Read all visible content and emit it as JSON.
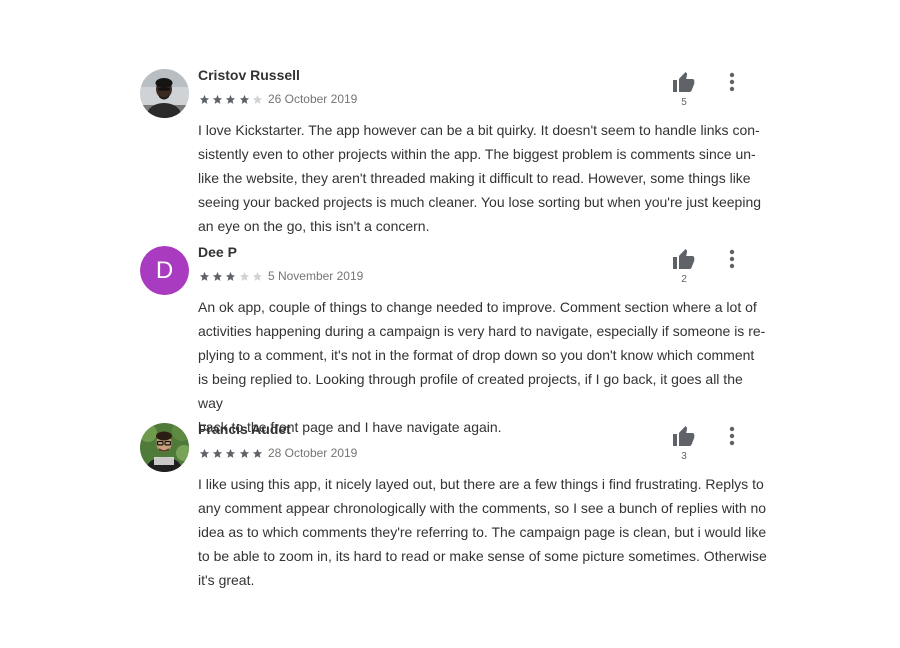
{
  "colors": {
    "star_filled": "#5f6368",
    "star_empty": "#d2d2d2",
    "avatar_dee": "#a93bc0",
    "icon": "#5f6368"
  },
  "icons": {
    "like": "thumbs-up-icon",
    "more": "more-vertical-icon"
  },
  "reviews": [
    {
      "name": "Cristov Russell",
      "rating": 4,
      "max_rating": 5,
      "date": "26 October 2019",
      "likes": "5",
      "lines": [
        "I love Kickstarter. The app however can be a bit quirky. It doesn't seem to handle links con-",
        "sistently even to other projects within the app. The biggest problem is comments since un-",
        "like the website, they aren't threaded making it difficult to read. However, some things like",
        "seeing your backed projects is much cleaner. You lose sorting but when you're just keeping",
        "an eye on the go, this isn't a concern."
      ]
    },
    {
      "name": "Dee P",
      "avatar_letter": "D",
      "rating": 3,
      "max_rating": 5,
      "date": "5 November 2019",
      "likes": "2",
      "lines": [
        "An ok app, couple of things to change needed to improve. Comment section where a lot of",
        "activities happening during a campaign is very hard to navigate, especially if someone is re-",
        "plying to a comment, it's not in the format of drop down so you don't know which comment",
        "is being replied to. Looking through profile of created projects, if I go back, it goes all the way",
        "back to the front page and I have navigate again."
      ]
    },
    {
      "name": "Francis Audet",
      "rating": 5,
      "max_rating": 5,
      "date": "28 October 2019",
      "likes": "3",
      "lines": [
        "I like using this app, it nicely layed out, but there are a few things i find frustrating. Replys to",
        "any comment appear chronologically with the comments, so I see a bunch of replies with no",
        "idea as to which comments they're referring to. The campaign page is clean, but i would like",
        "to be able to zoom in, its hard to read or make sense of some picture sometimes. Otherwise",
        "it's great."
      ]
    }
  ]
}
